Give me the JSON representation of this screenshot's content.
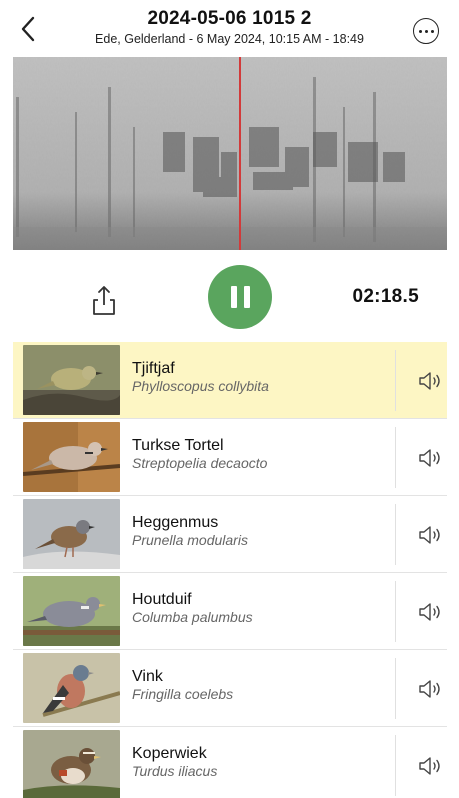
{
  "header": {
    "title": "2024-05-06 1015 2",
    "subtitle": "Ede, Gelderland - 6 May 2024, 10:15 AM - 18:49",
    "back_icon": "chevron-left-icon",
    "more_icon": "more-horizontal-icon"
  },
  "player": {
    "time": "02:18.5",
    "state": "playing",
    "accent_color": "#5aa55e",
    "playhead_color": "#d23a3a"
  },
  "species": [
    {
      "common": "Tjiftjaf",
      "latin": "Phylloscopus collybita",
      "highlighted": true
    },
    {
      "common": "Turkse Tortel",
      "latin": "Streptopelia decaocto",
      "highlighted": false
    },
    {
      "common": "Heggenmus",
      "latin": "Prunella modularis",
      "highlighted": false
    },
    {
      "common": "Houtduif",
      "latin": "Columba palumbus",
      "highlighted": false
    },
    {
      "common": "Vink",
      "latin": "Fringilla coelebs",
      "highlighted": false
    },
    {
      "common": "Koperwiek",
      "latin": "Turdus iliacus",
      "highlighted": false
    }
  ],
  "highlight_color": "#fdf6c4"
}
